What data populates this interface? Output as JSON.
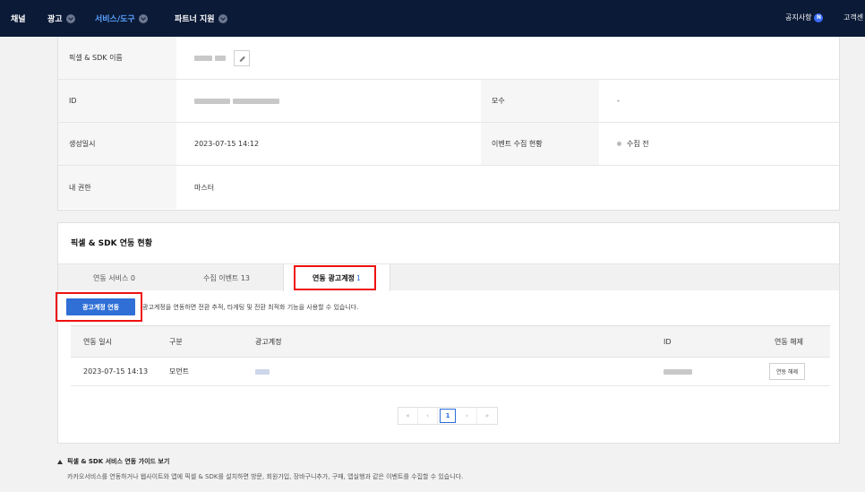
{
  "nav": {
    "items": [
      {
        "label": "채널",
        "chevron": false,
        "active": false
      },
      {
        "label": "광고",
        "chevron": true,
        "active": false
      },
      {
        "label": "서비스/도구",
        "chevron": true,
        "active": true
      },
      {
        "label": "파트너 지원",
        "chevron": true,
        "active": false
      }
    ],
    "notice_label": "공지사항",
    "notice_badge": "N",
    "customer_label": "고객센"
  },
  "info": {
    "name_label": "픽셀 & SDK 이름",
    "id_label": "ID",
    "mother_label": "모수",
    "mother_value": "-",
    "created_label": "생성일시",
    "created_value": "2023-07-15 14:12",
    "event_label": "이벤트 수집 현황",
    "event_value": "수집 전",
    "role_label": "내 권한",
    "role_value": "마스터"
  },
  "integration": {
    "title": "픽셀 & SDK 연동 현황",
    "tabs": [
      {
        "label": "연동 서비스",
        "count": "0"
      },
      {
        "label": "수집 이벤트",
        "count": "13"
      },
      {
        "label": "연동 광고계정",
        "count": "1"
      }
    ],
    "active_tab": 2,
    "link_button": "광고계정 연동",
    "hint": "광고계정을 연동하면 전환 추적, 타게팅 및 전환 최적화 기능을 사용할 수 있습니다.",
    "columns": [
      "연동 일시",
      "구분",
      "광고계정",
      "ID",
      "연동 해제"
    ],
    "rows": [
      {
        "date": "2023-07-15 14:13",
        "type": "모먼트",
        "unlink": "연동 해제"
      }
    ],
    "pager": {
      "first": "«",
      "prev": "‹",
      "current": "1",
      "next": "›",
      "last": "»"
    }
  },
  "guide": {
    "title": "픽셀 & SDK 서비스 연동 가이드 보기",
    "desc": "카카오서비스를 연동하거나 웹사이트와 앱에 픽셀 & SDK를 설치하면 방문, 회원가입, 장바구니추가, 구매, 앱실행과 같은 이벤트를 수집할 수 있습니다."
  },
  "colors": {
    "nav_bg": "#0b1a37",
    "accent": "#2f6fd6",
    "highlight": "#e11111"
  }
}
